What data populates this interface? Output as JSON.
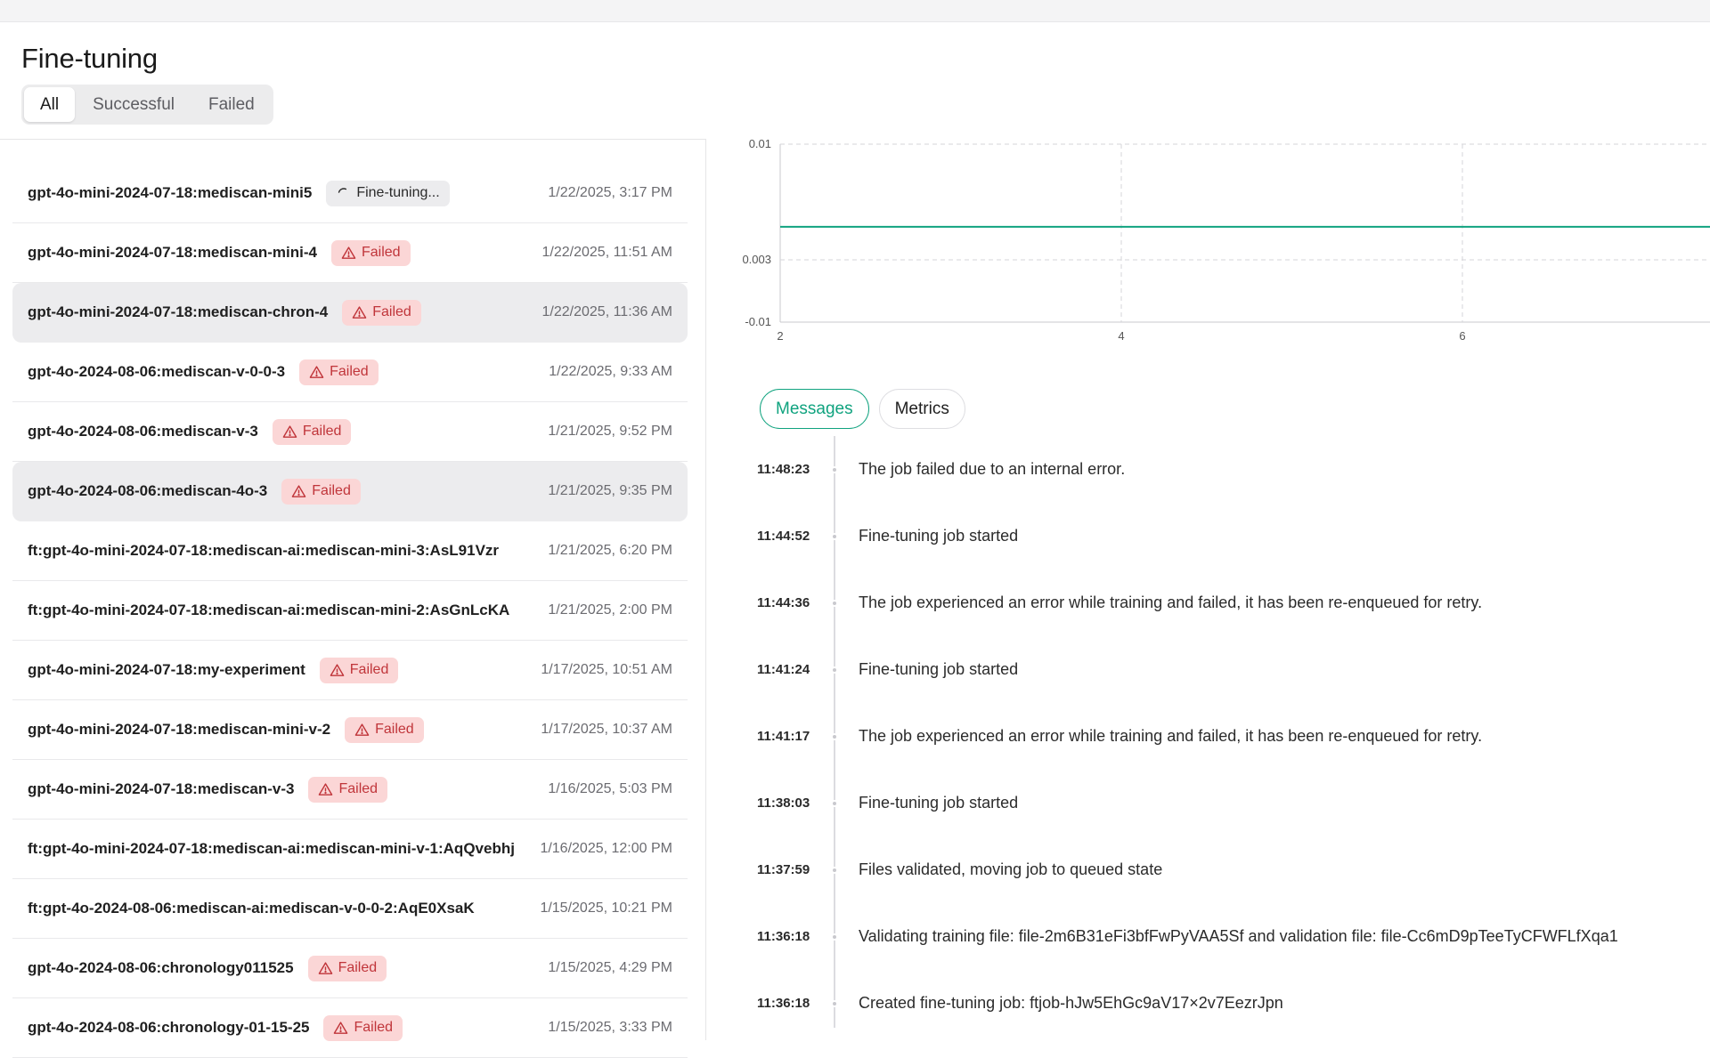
{
  "page": {
    "title": "Fine-tuning"
  },
  "filters": [
    {
      "label": "All",
      "active": true
    },
    {
      "label": "Successful",
      "active": false
    },
    {
      "label": "Failed",
      "active": false
    }
  ],
  "jobs": [
    {
      "name": "gpt-4o-mini-2024-07-18:mediscan-mini5",
      "status": "running",
      "status_label": "Fine-tuning...",
      "date": "1/22/2025, 3:17 PM",
      "selected": false
    },
    {
      "name": "gpt-4o-mini-2024-07-18:mediscan-mini-4",
      "status": "failed",
      "status_label": "Failed",
      "date": "1/22/2025, 11:51 AM",
      "selected": false
    },
    {
      "name": "gpt-4o-mini-2024-07-18:mediscan-chron-4",
      "status": "failed",
      "status_label": "Failed",
      "date": "1/22/2025, 11:36 AM",
      "selected": true
    },
    {
      "name": "gpt-4o-2024-08-06:mediscan-v-0-0-3",
      "status": "failed",
      "status_label": "Failed",
      "date": "1/22/2025, 9:33 AM",
      "selected": false
    },
    {
      "name": "gpt-4o-2024-08-06:mediscan-v-3",
      "status": "failed",
      "status_label": "Failed",
      "date": "1/21/2025, 9:52 PM",
      "selected": false
    },
    {
      "name": "gpt-4o-2024-08-06:mediscan-4o-3",
      "status": "failed",
      "status_label": "Failed",
      "date": "1/21/2025, 9:35 PM",
      "selected": true
    },
    {
      "name": "ft:gpt-4o-mini-2024-07-18:mediscan-ai:mediscan-mini-3:AsL91Vzr",
      "status": "none",
      "status_label": "",
      "date": "1/21/2025, 6:20 PM",
      "selected": false
    },
    {
      "name": "ft:gpt-4o-mini-2024-07-18:mediscan-ai:mediscan-mini-2:AsGnLcKA",
      "status": "none",
      "status_label": "",
      "date": "1/21/2025, 2:00 PM",
      "selected": false
    },
    {
      "name": "gpt-4o-mini-2024-07-18:my-experiment",
      "status": "failed",
      "status_label": "Failed",
      "date": "1/17/2025, 10:51 AM",
      "selected": false
    },
    {
      "name": "gpt-4o-mini-2024-07-18:mediscan-mini-v-2",
      "status": "failed",
      "status_label": "Failed",
      "date": "1/17/2025, 10:37 AM",
      "selected": false
    },
    {
      "name": "gpt-4o-mini-2024-07-18:mediscan-v-3",
      "status": "failed",
      "status_label": "Failed",
      "date": "1/16/2025, 5:03 PM",
      "selected": false
    },
    {
      "name": "ft:gpt-4o-mini-2024-07-18:mediscan-ai:mediscan-mini-v-1:AqQvebhj",
      "status": "none",
      "status_label": "",
      "date": "1/16/2025, 12:00 PM",
      "selected": false
    },
    {
      "name": "ft:gpt-4o-2024-08-06:mediscan-ai:mediscan-v-0-0-2:AqE0XsaK",
      "status": "none",
      "status_label": "",
      "date": "1/15/2025, 10:21 PM",
      "selected": false
    },
    {
      "name": "gpt-4o-2024-08-06:chronology011525",
      "status": "failed",
      "status_label": "Failed",
      "date": "1/15/2025, 4:29 PM",
      "selected": false
    },
    {
      "name": "gpt-4o-2024-08-06:chronology-01-15-25",
      "status": "failed",
      "status_label": "Failed",
      "date": "1/15/2025, 3:33 PM",
      "selected": false
    }
  ],
  "chart_data": {
    "type": "line",
    "title": "",
    "xlabel": "",
    "ylabel": "",
    "y_ticks": [
      "0.01",
      "0.003",
      "-0.01"
    ],
    "x_ticks": [
      "2",
      "4",
      "6"
    ],
    "grid": true,
    "series": [
      {
        "color": "#10a37f",
        "x": [
          2,
          8
        ],
        "y": [
          0.005,
          0.005
        ]
      }
    ]
  },
  "detail_tabs": [
    {
      "label": "Messages",
      "active": true
    },
    {
      "label": "Metrics",
      "active": false
    }
  ],
  "events": [
    {
      "time": "11:48:23",
      "message": "The job failed due to an internal error."
    },
    {
      "time": "11:44:52",
      "message": "Fine-tuning job started"
    },
    {
      "time": "11:44:36",
      "message": "The job experienced an error while training and failed, it has been re-enqueued for retry."
    },
    {
      "time": "11:41:24",
      "message": "Fine-tuning job started"
    },
    {
      "time": "11:41:17",
      "message": "The job experienced an error while training and failed, it has been re-enqueued for retry."
    },
    {
      "time": "11:38:03",
      "message": "Fine-tuning job started"
    },
    {
      "time": "11:37:59",
      "message": "Files validated, moving job to queued state"
    },
    {
      "time": "11:36:18",
      "message": "Validating training file: file-2m6B31eFi3bfFwPyVAA5Sf and validation file: file-Cc6mD9pTeeTyCFWFLfXqa1"
    },
    {
      "time": "11:36:18",
      "message": "Created fine-tuning job: ftjob-hJw5EhGc9aV17×2v7EezrJpn"
    }
  ]
}
